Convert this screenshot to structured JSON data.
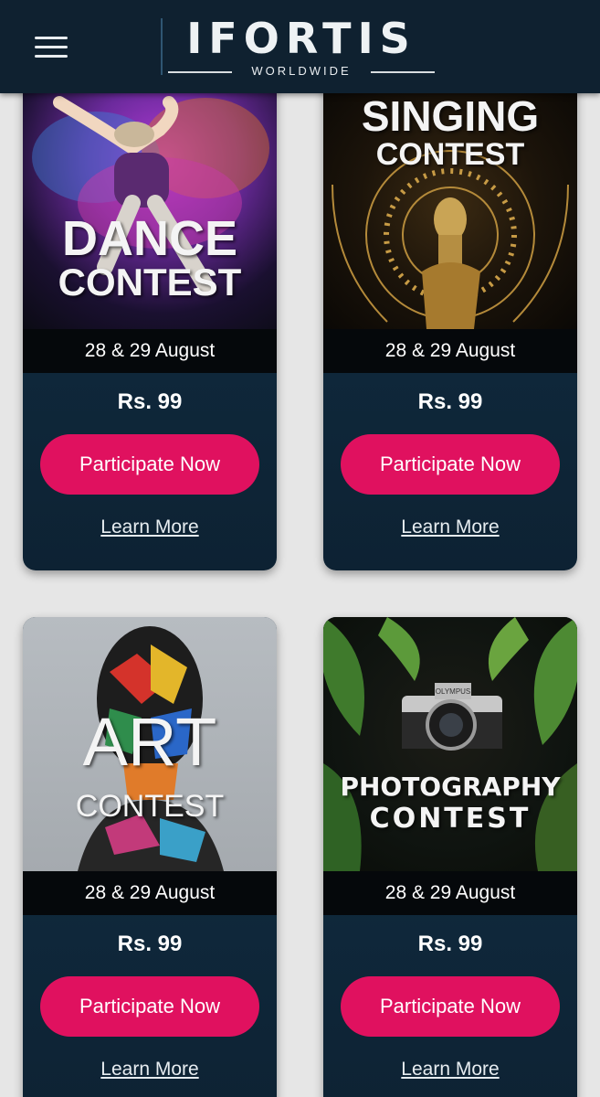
{
  "header": {
    "logo_main": "IFORTIS",
    "logo_sub": "WORLDWIDE"
  },
  "contests": [
    {
      "title_line1": "DANCE",
      "title_line2": "CONTEST",
      "date": "28 & 29 August",
      "price": "Rs. 99",
      "cta": "Participate Now",
      "learn": "Learn More"
    },
    {
      "title_line1": "SINGING",
      "title_line2": "CONTEST",
      "date": "28 & 29 August",
      "price": "Rs. 99",
      "cta": "Participate Now",
      "learn": "Learn More"
    },
    {
      "title_line1": "ART",
      "title_line2": "CONTEST",
      "date": "28 & 29 August",
      "price": "Rs. 99",
      "cta": "Participate Now",
      "learn": "Learn More"
    },
    {
      "title_line1": "PHOTOGRAPHY",
      "title_line2": "CONTEST",
      "camera_brand": "OLYMPUS",
      "date": "28 & 29 August",
      "price": "Rs. 99",
      "cta": "Participate Now",
      "learn": "Learn More"
    }
  ],
  "colors": {
    "header_bg": "#0f2130",
    "card_bg": "#0c2234",
    "button": "#e0115f",
    "page_bg": "#e6e6e6"
  }
}
